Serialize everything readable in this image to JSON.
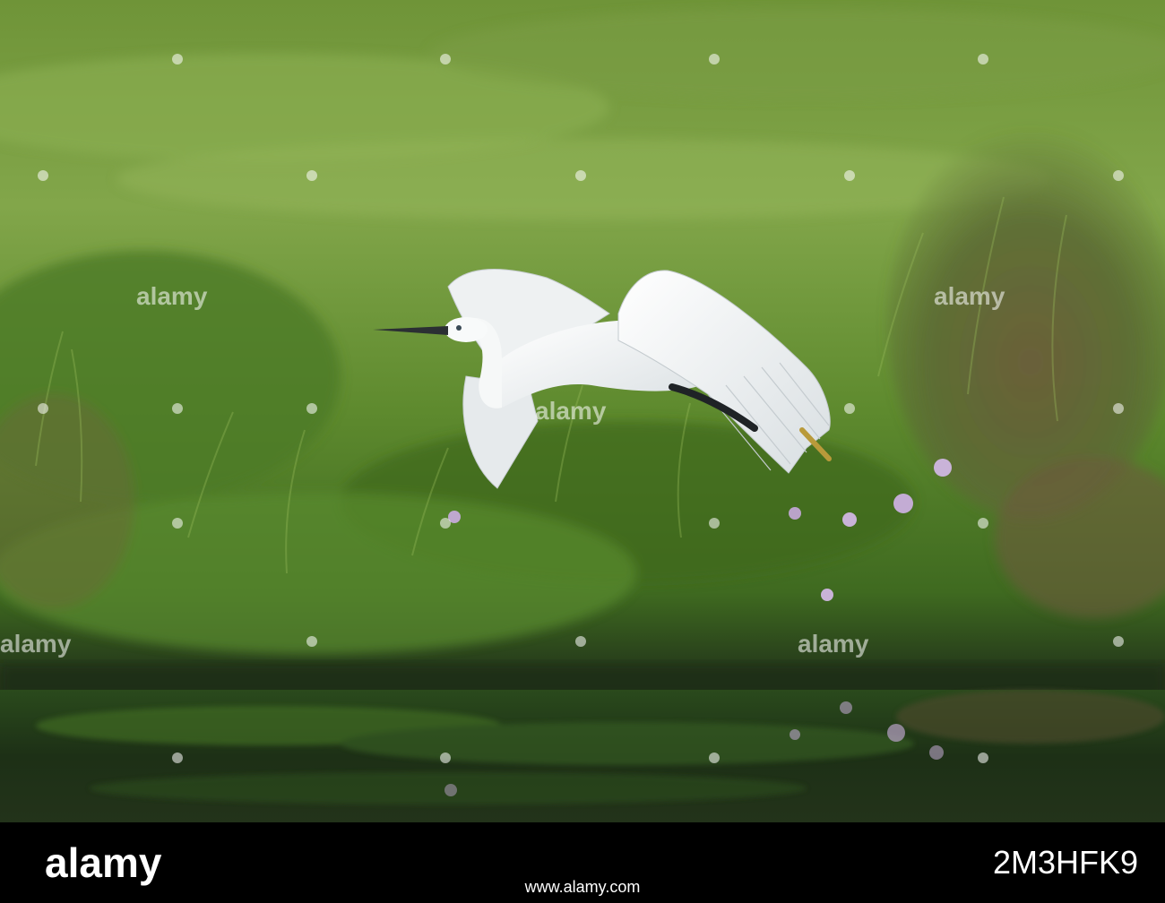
{
  "photo": {
    "subject": "little-egret-in-flight",
    "colors": {
      "grass_light": "#7fa043",
      "grass_mid": "#5e8a2e",
      "grass_dark": "#2f4d18",
      "water": "#1c2a14",
      "bird": "#f4f6f6",
      "beak": "#2b2f33",
      "flowers": "#c9b3d8"
    }
  },
  "watermark": {
    "text": "alamy"
  },
  "footer": {
    "logo_text": "alamy",
    "image_id": "2M3HFK9",
    "url": "www.alamy.com",
    "background": "#000000"
  }
}
